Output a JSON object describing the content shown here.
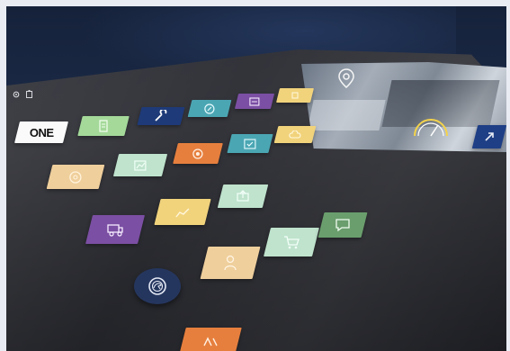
{
  "colors": {
    "one_tile": "#fafafa",
    "green": "#a4d99a",
    "navy": "#1e3a78",
    "teal": "#4ba6b3",
    "purple": "#7b4fa3",
    "yellow": "#f1d37c",
    "peach": "#efcf9c",
    "mint": "#bfe3cd",
    "orange": "#e67f3e",
    "sage": "#6a9e6d",
    "badge": "#25365e"
  },
  "one_tile": {
    "label": "ONE"
  },
  "status_icons": [
    "settings-icon",
    "battery-icon"
  ],
  "tiles": [
    {
      "name": "tile-green-document",
      "color": "#a4d99a",
      "icon": "document-icon"
    },
    {
      "name": "tile-navy-wrench",
      "color": "#1e3a78",
      "icon": "wrench-icon"
    },
    {
      "name": "tile-teal-compass",
      "color": "#4ba6b3",
      "icon": "compass-icon"
    },
    {
      "name": "tile-purple-card",
      "color": "#7b4fa3",
      "icon": "card-icon"
    },
    {
      "name": "tile-yellow-top",
      "color": "#f1d37c",
      "icon": "blank-icon"
    },
    {
      "name": "tile-peach-circle",
      "color": "#efcf9c",
      "icon": "circle-icon"
    },
    {
      "name": "tile-mint-chart",
      "color": "#bfe3cd",
      "icon": "chart-icon"
    },
    {
      "name": "tile-orange-gps",
      "color": "#e67f3e",
      "icon": "gps-icon"
    },
    {
      "name": "tile-teal-check",
      "color": "#4ba6b3",
      "icon": "check-icon"
    },
    {
      "name": "tile-yellow-cloud",
      "color": "#f1d37c",
      "icon": "cloud-icon"
    },
    {
      "name": "tile-purple-truck",
      "color": "#7b4fa3",
      "icon": "truck-icon"
    },
    {
      "name": "tile-yellow-graph",
      "color": "#f1d37c",
      "icon": "graph-icon"
    },
    {
      "name": "tile-mint-upload",
      "color": "#bfe3cd",
      "icon": "upload-icon"
    },
    {
      "name": "tile-peach-person",
      "color": "#efcf9c",
      "icon": "person-icon"
    },
    {
      "name": "tile-mint-cart",
      "color": "#bfe3cd",
      "icon": "cart-icon"
    },
    {
      "name": "tile-sage-speech",
      "color": "#6a9e6d",
      "icon": "speech-bubble-icon"
    },
    {
      "name": "tile-orange-bottom",
      "color": "#e67f3e",
      "icon": "partial-icon"
    }
  ],
  "badge": {
    "icon": "griffin-emblem-icon",
    "color": "#25365e"
  },
  "media_panel": {
    "icons": [
      "location-pin-icon",
      "gauge-icon"
    ]
  },
  "corner_tile": {
    "color": "#1e3f86",
    "icon": "arrow-icon"
  }
}
